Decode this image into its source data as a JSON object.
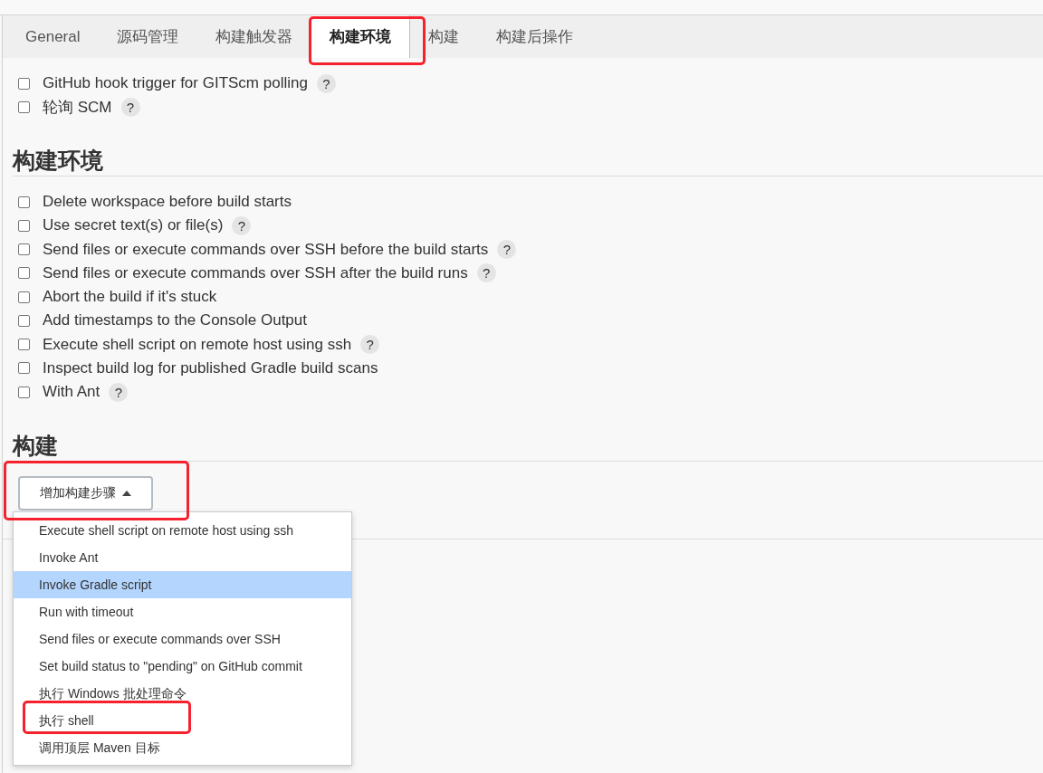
{
  "tabs": [
    {
      "label": "General",
      "selected": false,
      "highlighted": false
    },
    {
      "label": "源码管理",
      "selected": false,
      "highlighted": false
    },
    {
      "label": "构建触发器",
      "selected": false,
      "highlighted": false
    },
    {
      "label": "构建环境",
      "selected": true,
      "highlighted": true
    },
    {
      "label": "构建",
      "selected": false,
      "highlighted": false
    },
    {
      "label": "构建后操作",
      "selected": false,
      "highlighted": false
    }
  ],
  "trigger_options": [
    {
      "label": "GitHub hook trigger for GITScm polling",
      "checked": false,
      "help": "?"
    },
    {
      "label": "轮询 SCM",
      "checked": false,
      "help": "?"
    }
  ],
  "build_environment": {
    "title": "构建环境",
    "options": [
      {
        "label": "Delete workspace before build starts",
        "checked": false
      },
      {
        "label": "Use secret text(s) or file(s)",
        "checked": false,
        "help": "?"
      },
      {
        "label": "Send files or execute commands over SSH before the build starts",
        "checked": false,
        "help": "?"
      },
      {
        "label": "Send files or execute commands over SSH after the build runs",
        "checked": false,
        "help": "?"
      },
      {
        "label": "Abort the build if it's stuck",
        "checked": false
      },
      {
        "label": "Add timestamps to the Console Output",
        "checked": false
      },
      {
        "label": "Execute shell script on remote host using ssh",
        "checked": false,
        "help": "?"
      },
      {
        "label": "Inspect build log for published Gradle build scans",
        "checked": false
      },
      {
        "label": "With Ant",
        "checked": false,
        "help": "?"
      }
    ]
  },
  "build": {
    "title": "构建",
    "add_step_button": {
      "label": "增加构建步骤",
      "expanded": true,
      "highlighted": true
    },
    "step_menu": [
      {
        "label": "Execute shell script on remote host using ssh",
        "selected": false,
        "highlighted": false
      },
      {
        "label": "Invoke Ant",
        "selected": false,
        "highlighted": false
      },
      {
        "label": "Invoke Gradle script",
        "selected": true,
        "highlighted": false
      },
      {
        "label": "Run with timeout",
        "selected": false,
        "highlighted": false
      },
      {
        "label": "Send files or execute commands over SSH",
        "selected": false,
        "highlighted": false
      },
      {
        "label": "Set build status to \"pending\" on GitHub commit",
        "selected": false,
        "highlighted": false
      },
      {
        "label": "执行 Windows 批处理命令",
        "selected": false,
        "highlighted": false
      },
      {
        "label": "执行 shell",
        "selected": false,
        "highlighted": true
      },
      {
        "label": "调用顶层 Maven 目标",
        "selected": false,
        "highlighted": false
      }
    ]
  }
}
